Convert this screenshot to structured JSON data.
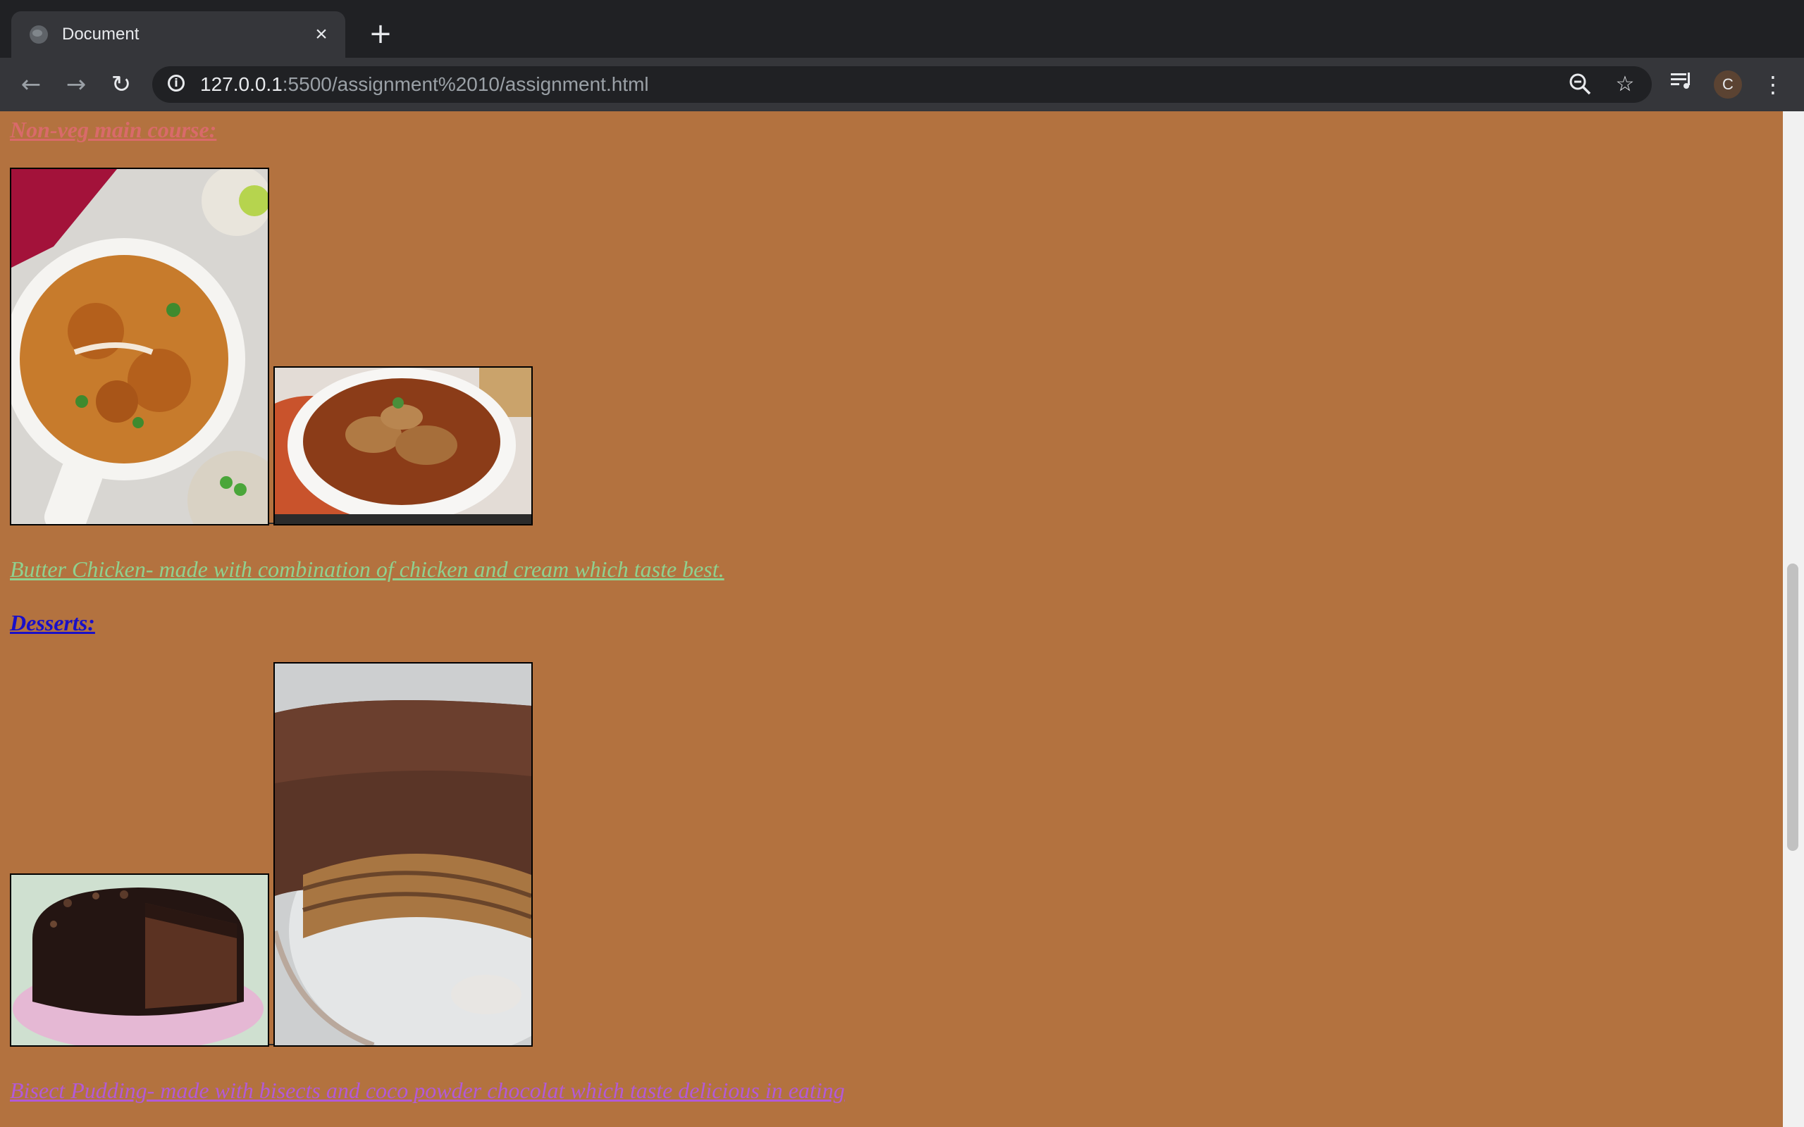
{
  "browser": {
    "tab": {
      "title": "Document",
      "close_glyph": "×"
    },
    "new_tab_glyph": "+",
    "nav": {
      "back_glyph": "←",
      "forward_glyph": "→",
      "reload_glyph": "↻"
    },
    "address": {
      "host": "127.0.0.1",
      "path": ":5500/assignment%2010/assignment.html"
    },
    "icons": [
      "site-info-icon",
      "zoom-icon",
      "bookmark-star-icon",
      "media-control-icon",
      "profile-avatar",
      "kebab-menu-icon"
    ],
    "avatar_letter": "C"
  },
  "page": {
    "background_color": "#b3723f",
    "nonveg_heading": "Non-veg main course:",
    "nonveg_heading_color": "#d96a6a",
    "nonveg_caption": "Butter Chicken- made with combination of chicken and cream which taste best.",
    "nonveg_caption_color": "#8fd18f",
    "desserts_heading": "Desserts:",
    "desserts_heading_color": "#1a10c8",
    "desserts_caption": "Bisect Pudding- made with bisects and coco powder chocolat which taste delicious in eating",
    "desserts_caption_color": "#b35ad6",
    "images": [
      {
        "name": "butter-chicken-image"
      },
      {
        "name": "chicken-curry-image"
      },
      {
        "name": "chocolate-cake-image"
      },
      {
        "name": "biscuit-pudding-image"
      }
    ]
  }
}
